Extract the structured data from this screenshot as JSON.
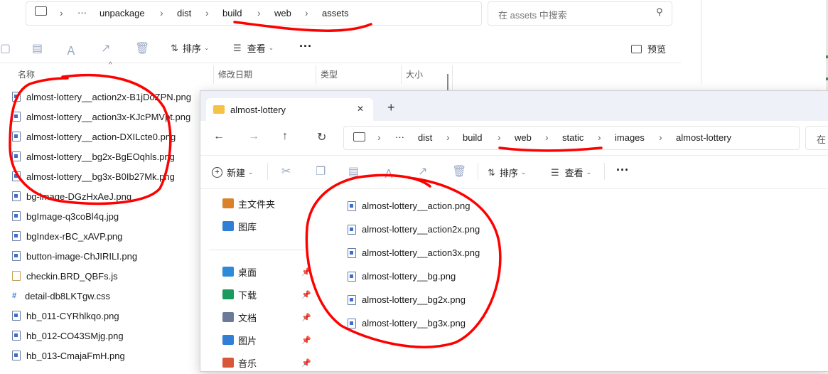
{
  "back_window": {
    "breadcrumb": [
      "unpackage",
      "dist",
      "build",
      "web",
      "assets"
    ],
    "more_label": "···",
    "search_placeholder": "在 assets 中搜索",
    "toolbar": {
      "sort_label": "排序",
      "view_label": "查看",
      "more_label": "···",
      "preview_label": "预览"
    },
    "columns": [
      "名称",
      "修改日期",
      "类型",
      "大小"
    ],
    "files": [
      {
        "name": "almost-lottery__action2x-B1jDoZPN.png",
        "kind": "img"
      },
      {
        "name": "almost-lottery__action3x-KJcPMVpt.png",
        "kind": "img"
      },
      {
        "name": "almost-lottery__action-DXILcte0.png",
        "kind": "img"
      },
      {
        "name": "almost-lottery__bg2x-BgEOqhls.png",
        "kind": "img"
      },
      {
        "name": "almost-lottery__bg3x-B0Ib27Mk.png",
        "kind": "img"
      },
      {
        "name": "bg-image-DGzHxAeJ.png",
        "kind": "img"
      },
      {
        "name": "bgImage-q3coBl4q.jpg",
        "kind": "img"
      },
      {
        "name": "bgIndex-rBC_xAVP.png",
        "kind": "img"
      },
      {
        "name": "button-image-ChJIRILI.png",
        "kind": "img"
      },
      {
        "name": "checkin.BRD_QBFs.js",
        "kind": "js"
      },
      {
        "name": "detail-db8LKTgw.css",
        "kind": "css"
      },
      {
        "name": "hb_011-CYRhlkqo.png",
        "kind": "img"
      },
      {
        "name": "hb_012-CO43SMjg.png",
        "kind": "img"
      },
      {
        "name": "hb_013-CmajaFmH.png",
        "kind": "img"
      }
    ]
  },
  "front_window": {
    "tab_title": "almost-lottery",
    "close_glyph": "✕",
    "new_tab_glyph": "+",
    "breadcrumb": [
      "dist",
      "build",
      "web",
      "static",
      "images",
      "almost-lottery"
    ],
    "more_label": "···",
    "search_partial": "在",
    "toolbar": {
      "new_label": "新建",
      "sort_label": "排序",
      "view_label": "查看",
      "more_label": "···"
    },
    "sidebar": [
      {
        "label": "主文件夹",
        "icon": "home-icon",
        "pinned": false
      },
      {
        "label": "图库",
        "icon": "gallery-icon",
        "pinned": false
      },
      {
        "label": "桌面",
        "icon": "desktop-icon",
        "pinned": true
      },
      {
        "label": "下载",
        "icon": "download-icon",
        "pinned": true
      },
      {
        "label": "文档",
        "icon": "documents-icon",
        "pinned": true
      },
      {
        "label": "图片",
        "icon": "pictures-icon",
        "pinned": true
      },
      {
        "label": "音乐",
        "icon": "music-icon",
        "pinned": true
      }
    ],
    "files": [
      "almost-lottery__action.png",
      "almost-lottery__action2x.png",
      "almost-lottery__action3x.png",
      "almost-lottery__bg.png",
      "almost-lottery__bg2x.png",
      "almost-lottery__bg3x.png"
    ]
  },
  "colors": {
    "annotation": "#ff0000",
    "tab_bar": "#eef1f8",
    "folder": "#f5c243"
  }
}
